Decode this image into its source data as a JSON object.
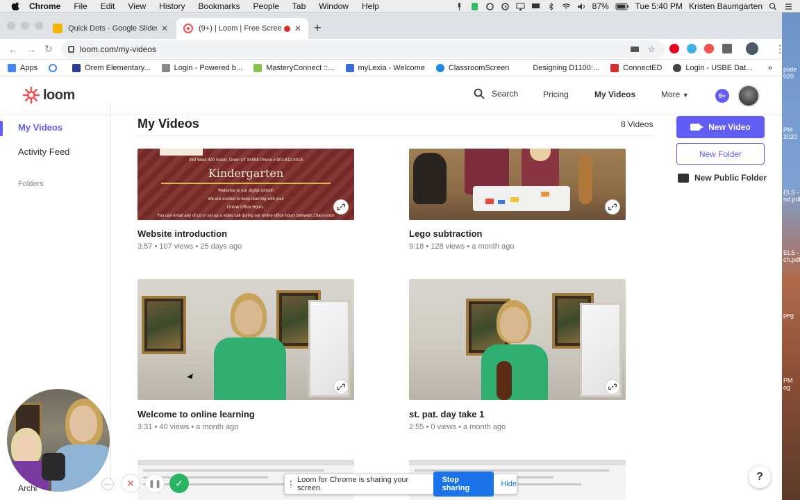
{
  "menubar": {
    "app": "Chrome",
    "items": [
      "File",
      "Edit",
      "View",
      "History",
      "Bookmarks",
      "People",
      "Tab",
      "Window",
      "Help"
    ],
    "battery": "87%",
    "clock": "Tue 5:40 PM",
    "user": "Kristen Baumgarten"
  },
  "desktop_labels": [
    "plate",
    "020",
    "PM",
    "2020",
    "ELS -",
    "nd.pdf",
    "ELS -",
    "ch.pdf",
    "peg",
    "PM",
    "og"
  ],
  "browser": {
    "tabs": [
      {
        "title": "Quick Dots - Google Slides",
        "favicon_color": "#f4b400"
      },
      {
        "title": "(9+) | Loom | Free Screen &",
        "favicon_color": "#f5504d"
      }
    ],
    "url": "loom.com/my-videos",
    "bookmarks": [
      {
        "label": "Apps",
        "color": "#4285f4"
      },
      {
        "label": "",
        "color": "#4285f4"
      },
      {
        "label": "Orem Elementary...",
        "color": "#2c3e91"
      },
      {
        "label": "Login - Powered b...",
        "color": "#6a6a6a"
      },
      {
        "label": "MasteryConnect ::...",
        "color": "#8bc34a"
      },
      {
        "label": "myLexia - Welcome",
        "color": "#3b6fd6"
      },
      {
        "label": "ClassroomScreen",
        "color": "#1e88e5"
      },
      {
        "label": "Designing D1100:...",
        "color": "#ffffff"
      },
      {
        "label": "ConnectED",
        "color": "#d32f2f"
      },
      {
        "label": "Login - USBE Dat...",
        "color": "#444444"
      }
    ],
    "bookmarks_more": "»"
  },
  "loom": {
    "brand": "loom",
    "accent": "#625df5",
    "nav": {
      "search": "Search",
      "pricing": "Pricing",
      "my_videos": "My Videos",
      "more": "More"
    },
    "notifications": "9+",
    "sidebar": {
      "my_videos": "My Videos",
      "activity": "Activity Feed",
      "folders": "Folders",
      "archive": "Archi"
    },
    "page_title": "My Videos",
    "video_count": "8 Videos",
    "actions": {
      "new_video": "New Video",
      "new_folder": "New Folder",
      "new_public_folder": "New Public Folder"
    },
    "videos": [
      {
        "title": "Website introduction",
        "duration": "3:57",
        "views": "107 views",
        "age": "25 days ago"
      },
      {
        "title": "Lego subtraction",
        "duration": "9:18",
        "views": "128 views",
        "age": "a month ago"
      },
      {
        "title": "Welcome to online learning",
        "duration": "3:31",
        "views": "40 views",
        "age": "a month ago"
      },
      {
        "title": "st. pat. day take 1",
        "duration": "2:55",
        "views": "0 views",
        "age": "a month ago"
      }
    ],
    "kindergarten_thumb": {
      "address": "450 West 400 South, Orem UT 84058     Phone # 801-610-8016",
      "heading": "Kindergarten",
      "line1": "Welcome to our digital school!",
      "line2": "We are excited to keep learning with you!",
      "line3": "Online Office Hours:",
      "line4": "You can email any of us or set up a video call during our online office hours between 10am-noon"
    }
  },
  "recorder": {
    "sharing_text": "Loom for Chrome is sharing your screen.",
    "stop": "Stop sharing",
    "hide": "Hide",
    "more": "···",
    "cancel": "✕",
    "pause": "❚❚",
    "done": "✓"
  },
  "help": "?"
}
